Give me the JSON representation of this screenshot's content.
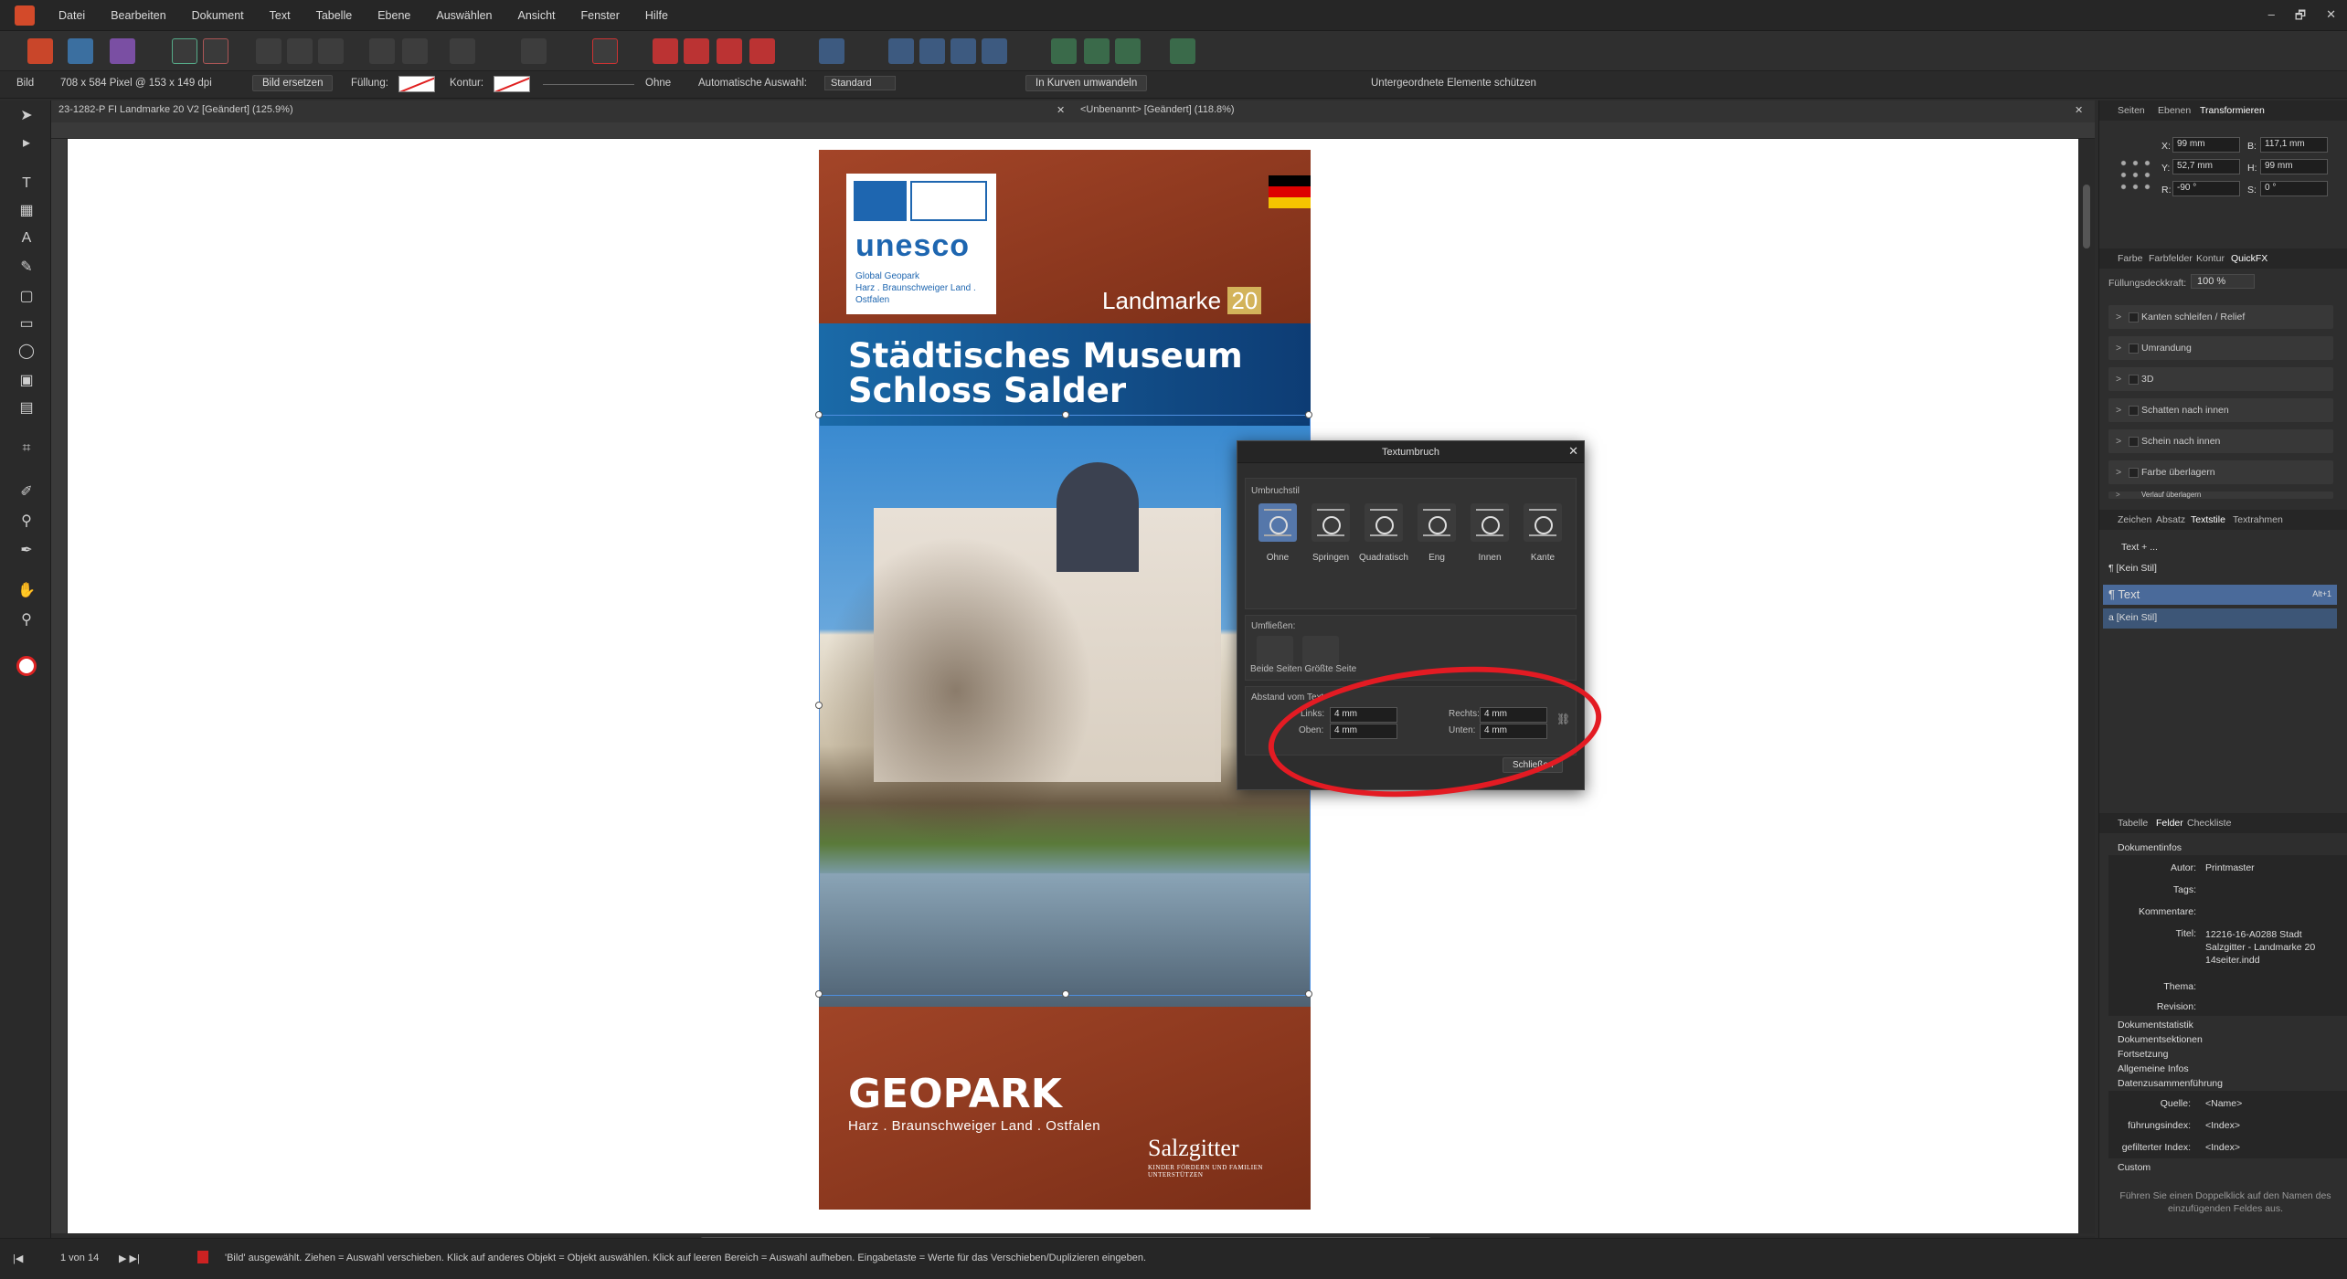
{
  "menu": {
    "items": [
      "Datei",
      "Bearbeiten",
      "Dokument",
      "Text",
      "Tabelle",
      "Ebene",
      "Auswählen",
      "Ansicht",
      "Fenster",
      "Hilfe"
    ],
    "window_controls": [
      "–",
      "🗗",
      "✕"
    ]
  },
  "context_toolbar": {
    "mode_label": "Bild",
    "info": "708 x 584 Pixel @ 153 x 149 dpi",
    "replace_btn": "Bild ersetzen",
    "fill_label": "Füllung:",
    "stroke_label": "Kontur:",
    "stroke_value": "Ohne",
    "auto_select_label": "Automatische Auswahl:",
    "auto_select_value": "Standard",
    "to_curves_btn": "In Kurven umwandeln",
    "protect_label": "Untergeordnete Elemente schützen"
  },
  "doc_tabs": [
    {
      "label": "23-1282-P FI Landmarke 20 V2 [Geändert] (125.9%)"
    },
    {
      "label": "<Unbenannt> [Geändert] (118.8%)"
    }
  ],
  "flyer": {
    "unesco_word": "unesco",
    "unesco_sub": "Global Geopark\nHarz . Braunschweiger Land .\nOstfalen",
    "landmarke_label": "Landmarke",
    "landmarke_num": "20",
    "title_line1": "Städtisches Museum",
    "title_line2": "Schloss Salder",
    "geopark": "GEOPARK",
    "geopark_sub": "Harz . Braunschweiger Land . Ostfalen",
    "salzgitter": "Salzgitter",
    "salzgitter_sub": "KINDER FÖRDERN UND FAMILIEN UNTERSTÜTZEN"
  },
  "dialog": {
    "title": "Textumbruch",
    "close": "✕",
    "wrap_style_label": "Umbruchstil",
    "wrap_styles": [
      {
        "name": "Ohne",
        "selected": true
      },
      {
        "name": "Springen",
        "selected": false
      },
      {
        "name": "Quadratisch",
        "selected": false
      },
      {
        "name": "Eng",
        "selected": false
      },
      {
        "name": "Innen",
        "selected": false
      },
      {
        "name": "Kante",
        "selected": false
      }
    ],
    "flow_label": "Umfließen:",
    "flow_options": "Beide Seiten Größte Seite",
    "distance_label": "Abstand vom Text",
    "left_label": "Links:",
    "left_value": "4 mm",
    "top_label": "Oben:",
    "top_value": "4 mm",
    "right_label": "Rechts:",
    "right_value": "4 mm",
    "bottom_label": "Unten:",
    "bottom_value": "4 mm",
    "close_btn": "Schließen"
  },
  "right_panel": {
    "tabs1": [
      "Seiten",
      "Ebenen",
      "Transformieren"
    ],
    "transform": {
      "x_label": "X:",
      "x": "99 mm",
      "y_label": "Y:",
      "y": "52,7 mm",
      "w_label": "B:",
      "w": "117,1 mm",
      "h_label": "H:",
      "h": "99 mm",
      "r_label": "R:",
      "r": "-90 °",
      "s_label": "S:",
      "s": "0 °"
    },
    "tabs2": [
      "Farbe",
      "Farbfelder",
      "Kontur",
      "QuickFX"
    ],
    "opacity_label": "Füllungsdeckkraft:",
    "opacity_value": "100 %",
    "fx": [
      "Kanten schleifen / Relief",
      "Umrandung",
      "3D",
      "Schatten nach innen",
      "Schein nach innen",
      "Farbe überlagern",
      "Verlauf überlagern"
    ],
    "tabs3": [
      "Zeichen",
      "Absatz",
      "Textstile",
      "Textrahmen"
    ],
    "styles": [
      "Text + ...",
      "¶ [Kein Stil]",
      "¶ Text",
      "a [Kein Stil]"
    ],
    "style_shortcut": "Alt+1",
    "tabs4": [
      "Tabelle",
      "Felder",
      "Checkliste"
    ],
    "docinfo_header": "Dokumentinfos",
    "fields": [
      {
        "k": "Autor:",
        "v": "Printmaster"
      },
      {
        "k": "Tags:",
        "v": ""
      },
      {
        "k": "Kommentare:",
        "v": ""
      },
      {
        "k": "Titel:",
        "v": "12216-16-A0288 Stadt Salzgitter - Landmarke 20 14seiter.indd"
      },
      {
        "k": "Thema:",
        "v": ""
      },
      {
        "k": "Revision:",
        "v": ""
      }
    ],
    "sections": [
      "Dokumentstatistik",
      "Dokumentsektionen",
      "Fortsetzung",
      "Allgemeine Infos",
      "Datenzusammenführung"
    ],
    "merge_fields": [
      {
        "k": "Quelle:",
        "v": "<Name>"
      },
      {
        "k": "führungsindex:",
        "v": "<Index>"
      },
      {
        "k": "gefilterter Index:",
        "v": "<Index>"
      }
    ],
    "custom": "Custom",
    "hint": "Führen Sie einen Doppelklick auf den Namen des einzufügenden Feldes aus."
  },
  "status": {
    "page": "1 von 14",
    "message": "'Bild' ausgewählt. Ziehen = Auswahl verschieben. Klick auf anderes Objekt = Objekt auswählen. Klick auf leeren Bereich = Auswahl aufheben. Eingabetaste = Werte für das Verschieben/Duplizieren eingeben."
  },
  "colors": {
    "accent": "#5577aa",
    "annotation": "#e31b23",
    "flyer_brown": "#8f3a20",
    "banner_blue": "#1a6aa8"
  },
  "icons": [
    "affinity-logo",
    "move-tool-icon",
    "node-tool-icon",
    "frame-text-icon",
    "pen-icon",
    "rectangle-icon",
    "ellipse-icon",
    "crop-icon",
    "hand-icon",
    "zoom-icon",
    "color-picker-icon"
  ]
}
